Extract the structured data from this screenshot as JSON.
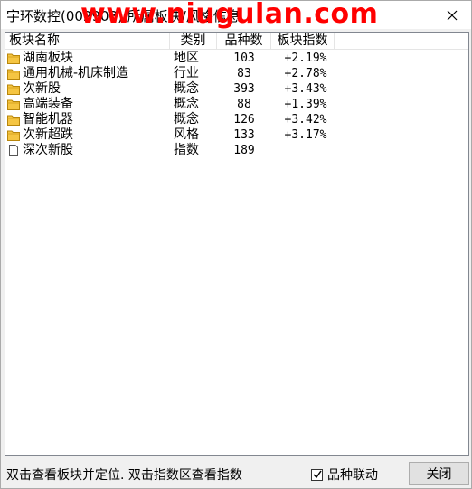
{
  "window": {
    "title": "宇环数控(002903) 所属板块/风格信息",
    "watermark": "www.niugulan.com"
  },
  "table": {
    "headers": [
      "板块名称",
      "类别",
      "品种数",
      "板块指数"
    ],
    "rows": [
      {
        "icon": "folder-icon",
        "name": "湖南板块",
        "type": "地区",
        "count": "103",
        "index": "+2.19%"
      },
      {
        "icon": "folder-icon",
        "name": "通用机械-机床制造",
        "type": "行业",
        "count": "83",
        "index": "+2.78%"
      },
      {
        "icon": "folder-icon",
        "name": "次新股",
        "type": "概念",
        "count": "393",
        "index": "+3.43%"
      },
      {
        "icon": "folder-icon",
        "name": "高端装备",
        "type": "概念",
        "count": "88",
        "index": "+1.39%"
      },
      {
        "icon": "folder-icon",
        "name": "智能机器",
        "type": "概念",
        "count": "126",
        "index": "+3.42%"
      },
      {
        "icon": "folder-icon",
        "name": "次新超跌",
        "type": "风格",
        "count": "133",
        "index": "+3.17%"
      },
      {
        "icon": "document-icon",
        "name": "深次新股",
        "type": "指数",
        "count": "189",
        "index": ""
      }
    ]
  },
  "status": {
    "hint": "双击查看板块并定位. 双击指数区查看指数",
    "linkage_label": "品种联动",
    "linkage_checked": true,
    "close_label": "关闭"
  },
  "colors": {
    "folder": "#f5c542",
    "watermark": "#ff0000"
  }
}
